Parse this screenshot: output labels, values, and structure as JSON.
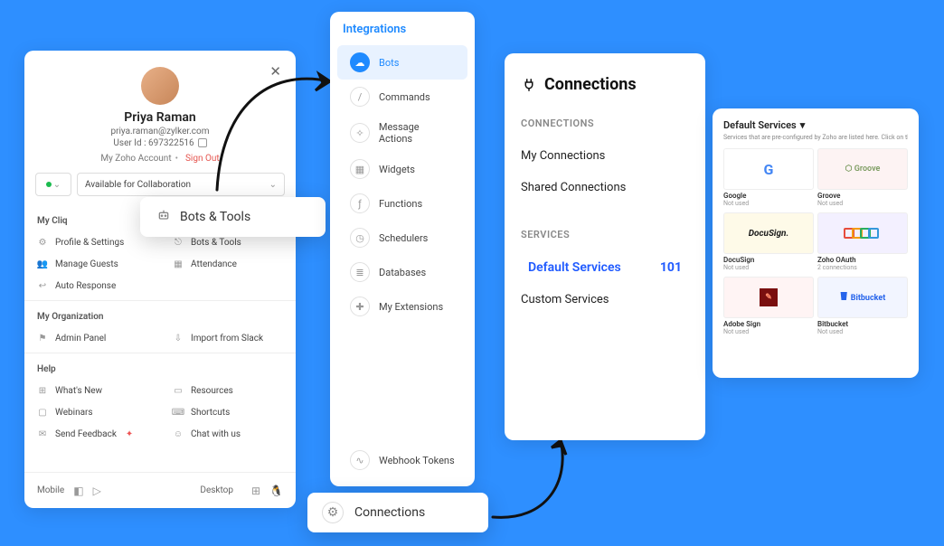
{
  "profile": {
    "name": "Priya Raman",
    "email": "priya.raman@zylker.com",
    "user_id_label": "User Id : 697322516",
    "account_label": "My Zoho Account",
    "signout": "Sign Out",
    "status_text": "Available for Collaboration",
    "sections": {
      "mycliq": "My Cliq",
      "myorg": "My Organization",
      "help": "Help"
    },
    "items": {
      "profile_settings": "Profile & Settings",
      "bots_tools": "Bots & Tools",
      "manage_guests": "Manage Guests",
      "attendance": "Attendance",
      "auto_response": "Auto Response",
      "admin_panel": "Admin Panel",
      "import_slack": "Import from Slack",
      "whats_new": "What's New",
      "resources": "Resources",
      "webinars": "Webinars",
      "shortcuts": "Shortcuts",
      "send_feedback": "Send Feedback",
      "chat_with_us": "Chat with us"
    },
    "footer": {
      "mobile": "Mobile",
      "desktop": "Desktop"
    }
  },
  "popup_bots_tools": "Bots & Tools",
  "integrations": {
    "title": "Integrations",
    "items": {
      "bots": "Bots",
      "commands": "Commands",
      "message_actions": "Message Actions",
      "widgets": "Widgets",
      "functions": "Functions",
      "schedulers": "Schedulers",
      "databases": "Databases",
      "my_extensions": "My Extensions",
      "webhook_tokens": "Webhook Tokens"
    }
  },
  "popup_connections": "Connections",
  "connections": {
    "title": "Connections",
    "section_connections": "CONNECTIONS",
    "my_connections": "My Connections",
    "shared_connections": "Shared Connections",
    "section_services": "SERVICES",
    "default_services": "Default Services",
    "default_count": "101",
    "custom_services": "Custom Services"
  },
  "services_panel": {
    "header": "Default Services",
    "desc": "Services that are pre-configured by Zoho are listed here. Click on the required service to quick",
    "cards": [
      {
        "name": "Google",
        "status": "Not used"
      },
      {
        "name": "Groove",
        "status": "Not used"
      },
      {
        "name": "DocuSign",
        "status": "Not used"
      },
      {
        "name": "Zoho OAuth",
        "status": "2 connections"
      },
      {
        "name": "Adobe Sign",
        "status": "Not used"
      },
      {
        "name": "Bitbucket",
        "status": "Not used"
      }
    ]
  }
}
